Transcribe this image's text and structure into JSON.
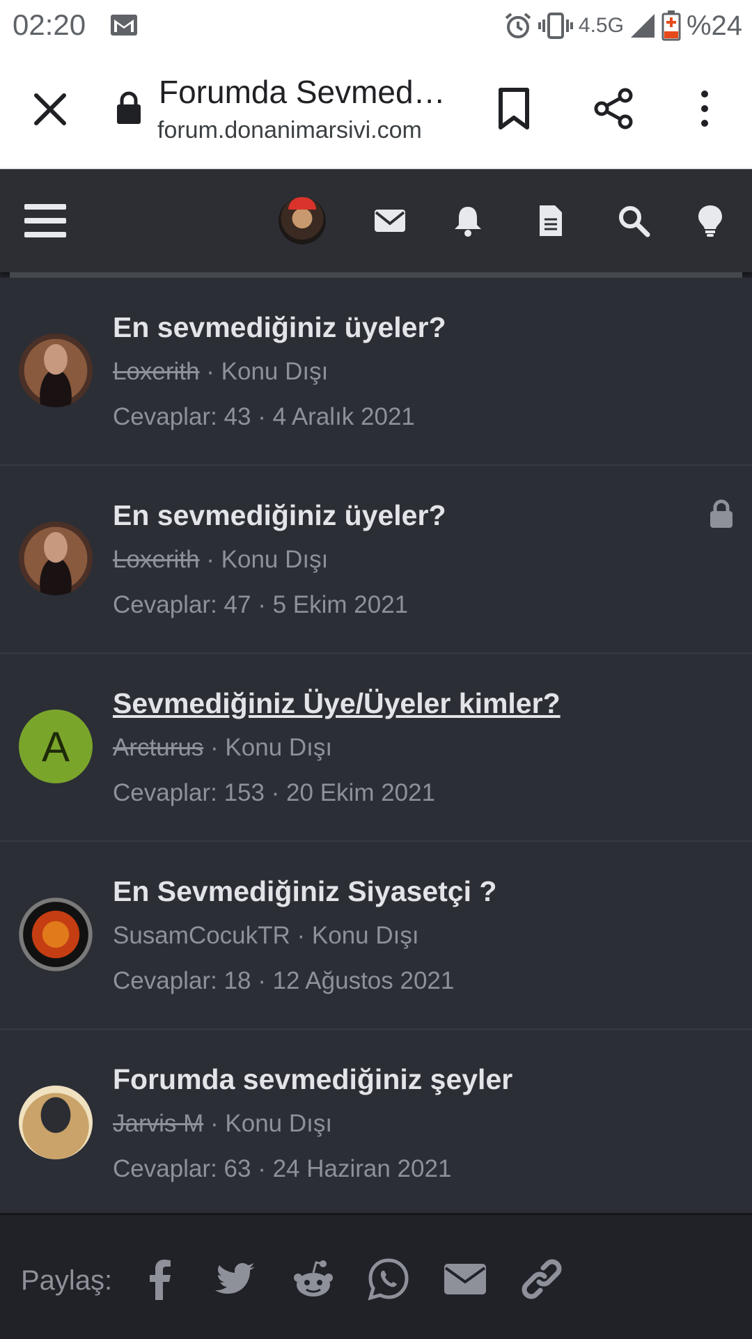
{
  "status_bar": {
    "time": "02:20",
    "network": "4.5G",
    "battery": "%24"
  },
  "browser": {
    "page_title": "Forumda Sevmed…",
    "host": "forum.donanimarsivi.com"
  },
  "threads": [
    {
      "title": "En sevmediğiniz üyeler?",
      "author": "Loxerith",
      "author_strike": true,
      "forum": "Konu Dışı",
      "replies_label": "Cevaplar:",
      "replies": "43",
      "date": "4 Aralık 2021",
      "locked": false,
      "underline": false,
      "avatar": "photo-woman",
      "avatar_letter": ""
    },
    {
      "title": "En sevmediğiniz üyeler?",
      "author": "Loxerith",
      "author_strike": true,
      "forum": "Konu Dışı",
      "replies_label": "Cevaplar:",
      "replies": "47",
      "date": "5 Ekim 2021",
      "locked": true,
      "underline": false,
      "avatar": "photo-woman",
      "avatar_letter": ""
    },
    {
      "title": "Sevmediğiniz Üye/Üyeler kimler?",
      "author": "Arcturus",
      "author_strike": true,
      "forum": "Konu Dışı",
      "replies_label": "Cevaplar:",
      "replies": "153",
      "date": "20 Ekim 2021",
      "locked": false,
      "underline": true,
      "avatar": "letter",
      "avatar_letter": "A"
    },
    {
      "title": "En Sevmediğiniz Siyasetçi ?",
      "author": "SusamCocukTR",
      "author_strike": false,
      "forum": "Konu Dışı",
      "replies_label": "Cevaplar:",
      "replies": "18",
      "date": "12 Ağustos 2021",
      "locked": false,
      "underline": false,
      "avatar": "emblem",
      "avatar_letter": ""
    },
    {
      "title": "Forumda sevmediğiniz şeyler",
      "author": "Jarvis M",
      "author_strike": true,
      "forum": "Konu Dışı",
      "replies_label": "Cevaplar:",
      "replies": "63",
      "date": "24 Haziran 2021",
      "locked": false,
      "underline": false,
      "avatar": "photo-hood",
      "avatar_letter": ""
    }
  ],
  "share": {
    "label": "Paylaş:",
    "icons": [
      "facebook-icon",
      "twitter-icon",
      "reddit-icon",
      "whatsapp-icon",
      "email-icon",
      "link-icon"
    ]
  },
  "colors": {
    "accent_letter_avatar": "#7aa52b",
    "background": "#2c2e36"
  }
}
